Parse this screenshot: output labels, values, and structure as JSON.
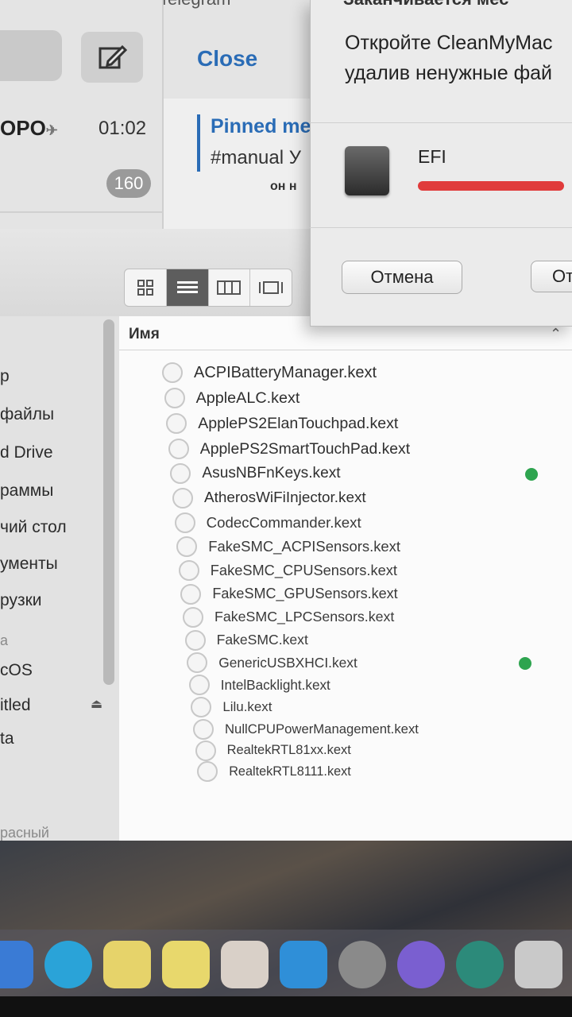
{
  "telegram": {
    "title": "Telegram",
    "close_label": "Close",
    "pinned_label": "Pinned me",
    "pinned_text": "#manual У",
    "line3": "он н",
    "chat": {
      "name": "OPO",
      "time": "01:02",
      "unread": "160"
    }
  },
  "dialog": {
    "title": "Заканчивается мес",
    "message_line1": "Откройте CleanMyMac",
    "message_line2": "удалив ненужные фай",
    "disk_name": "EFI",
    "disk_usage_fraction": 0.95,
    "cancel_label": "Отмена",
    "ok_label": "От",
    "colors": {
      "bar": "#e03b3b"
    }
  },
  "finder": {
    "view_modes": [
      "icon-view",
      "list-view",
      "column-view",
      "gallery-view"
    ],
    "active_view": "list-view",
    "column_name": "Имя",
    "sidebar_items": [
      {
        "label": "p",
        "faint": false
      },
      {
        "label": "файлы",
        "faint": false
      },
      {
        "label": "d Drive",
        "faint": false
      },
      {
        "label": "раммы",
        "faint": false
      },
      {
        "label": "чий стол",
        "faint": false
      },
      {
        "label": "ументы",
        "faint": false
      },
      {
        "label": "рузки",
        "faint": false
      },
      {
        "label": "а",
        "faint": true
      },
      {
        "label": "cOS",
        "faint": false
      },
      {
        "label": "itled",
        "faint": false
      },
      {
        "label": "ta",
        "faint": false
      },
      {
        "label": "расный",
        "faint": true
      }
    ],
    "files": [
      {
        "name": "ACPIBatteryManager.kext",
        "tag": false
      },
      {
        "name": "AppleALC.kext",
        "tag": false
      },
      {
        "name": "ApplePS2ElanTouchpad.kext",
        "tag": false
      },
      {
        "name": "ApplePS2SmartTouchPad.kext",
        "tag": false
      },
      {
        "name": "AsusNBFnKeys.kext",
        "tag": true
      },
      {
        "name": "AtherosWiFiInjector.kext",
        "tag": false
      },
      {
        "name": "CodecCommander.kext",
        "tag": false
      },
      {
        "name": "FakeSMC_ACPISensors.kext",
        "tag": false
      },
      {
        "name": "FakeSMC_CPUSensors.kext",
        "tag": false
      },
      {
        "name": "FakeSMC_GPUSensors.kext",
        "tag": false
      },
      {
        "name": "FakeSMC_LPCSensors.kext",
        "tag": false
      },
      {
        "name": "FakeSMC.kext",
        "tag": false
      },
      {
        "name": "GenericUSBXHCI.kext",
        "tag": true
      },
      {
        "name": "IntelBacklight.kext",
        "tag": false
      },
      {
        "name": "Lilu.kext",
        "tag": false
      },
      {
        "name": "NullCPUPowerManagement.kext",
        "tag": false
      },
      {
        "name": "RealtekRTL81xx.kext",
        "tag": false
      },
      {
        "name": "RealtekRTL8111.kext",
        "tag": false
      }
    ]
  },
  "dock": {
    "icons": [
      {
        "name": "finder-icon",
        "color": "#3a7bd5"
      },
      {
        "name": "telegram-icon",
        "color": "#2aa3d8"
      },
      {
        "name": "notes-icon",
        "color": "#e6d36a"
      },
      {
        "name": "stickies-icon",
        "color": "#e8d86c"
      },
      {
        "name": "itunes-icon",
        "color": "#d9d0c8"
      },
      {
        "name": "app-store-icon",
        "color": "#2f8fd8"
      },
      {
        "name": "system-preferences-icon",
        "color": "#8a8a8a"
      },
      {
        "name": "siri-icon",
        "color": "#7a5fd0"
      },
      {
        "name": "cleanmymac-icon",
        "color": "#2c8a7a"
      },
      {
        "name": "trash-icon",
        "color": "#c9c9c9"
      }
    ]
  }
}
